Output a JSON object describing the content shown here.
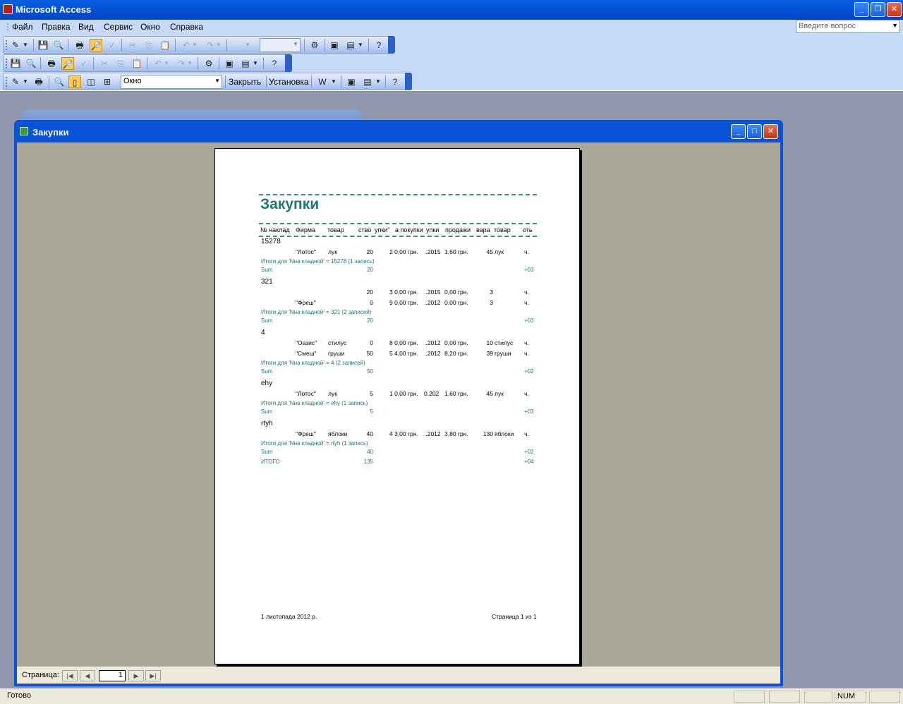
{
  "app": {
    "title": "Microsoft Access"
  },
  "menu": [
    "Файл",
    "Правка",
    "Вид",
    "Сервис",
    "Окно",
    "Справка"
  ],
  "ask": {
    "placeholder": "Введите вопрос"
  },
  "toolbar3": {
    "view_combo": "Окно",
    "close_label": "Закрыть",
    "setup_label": "Установка"
  },
  "report_window": {
    "title": "Закупки"
  },
  "report": {
    "title": "Закупки",
    "headers": [
      "№ наклад",
      "Фирма",
      "товар",
      "ство",
      "упки\"",
      "а покупки",
      "упки",
      "продажи",
      "вара",
      "товар",
      "оть"
    ],
    "groups": [
      {
        "id": "15278",
        "rows": [
          [
            "\"Лотос\"",
            "лук",
            "20",
            "2 0,00 грн.",
            "..2015",
            "1,60 грн.",
            "45",
            "лук",
            "ч."
          ]
        ],
        "summary": "Итоги для 'Nна кладной' =  15278 (1 запись)",
        "sum_label": "Sum",
        "sum_qty": "20",
        "sum_end": "+03"
      },
      {
        "id": "321",
        "rows": [
          [
            "",
            "",
            "20",
            "3 0,00 грн.",
            "..2015",
            "0,00 грн.",
            "3",
            "",
            "ч."
          ],
          [
            "\"Фреш\"",
            "",
            "0",
            "9 0,00 грн.",
            "..2012",
            "0,00 грн.",
            "3",
            "",
            "ч."
          ]
        ],
        "summary": "Итоги для 'Nна кладной' =  321 (2 записей)",
        "sum_label": "Sum",
        "sum_qty": "20",
        "sum_end": "+03"
      },
      {
        "id": "4",
        "rows": [
          [
            "\"Оазис\"",
            "стилус",
            "0",
            "8 0,00 грн.",
            "..2012",
            "0,00 грн.",
            "10",
            "стилус",
            "ч."
          ],
          [
            "\"Смеш\"",
            "груши",
            "50",
            "5 4,00 грн.",
            "..2012",
            "8,20 грн.",
            "39",
            "груши",
            "ч."
          ]
        ],
        "summary": "Итоги для 'Nна кладной' =  4 (2 записей)",
        "sum_label": "Sum",
        "sum_qty": "50",
        "sum_end": "+02"
      },
      {
        "id": "ehy",
        "rows": [
          [
            "\"Лотос\"",
            "лук",
            "5",
            "1 0,00 грн.",
            "0.202",
            "1,60 грн.",
            "45",
            "лук",
            "ч."
          ]
        ],
        "summary": "Итоги для 'Nна кладной' =  ehy (1 запись)",
        "sum_label": "Sum",
        "sum_qty": "5",
        "sum_end": "+03"
      },
      {
        "id": "rtyh",
        "rows": [
          [
            "\"Фреш\"",
            "яблоки",
            "40",
            "4 3,00 грн.",
            "..2012",
            "3,80 грн.",
            "130",
            "яблоки",
            "ч."
          ]
        ],
        "summary": "Итоги для 'Nна кладной' =  rtyh (1 запись)",
        "sum_label": "Sum",
        "sum_qty": "40",
        "sum_end": "+02"
      }
    ],
    "total": {
      "label": "ИТОГО",
      "qty": "135",
      "end": "+04"
    },
    "footer_date": "1 листопада 2012 р.",
    "footer_page": "Страница 1 из 1"
  },
  "nav": {
    "label": "Страница:",
    "page": "1"
  },
  "status": {
    "text": "Готово",
    "num": "NUM"
  }
}
